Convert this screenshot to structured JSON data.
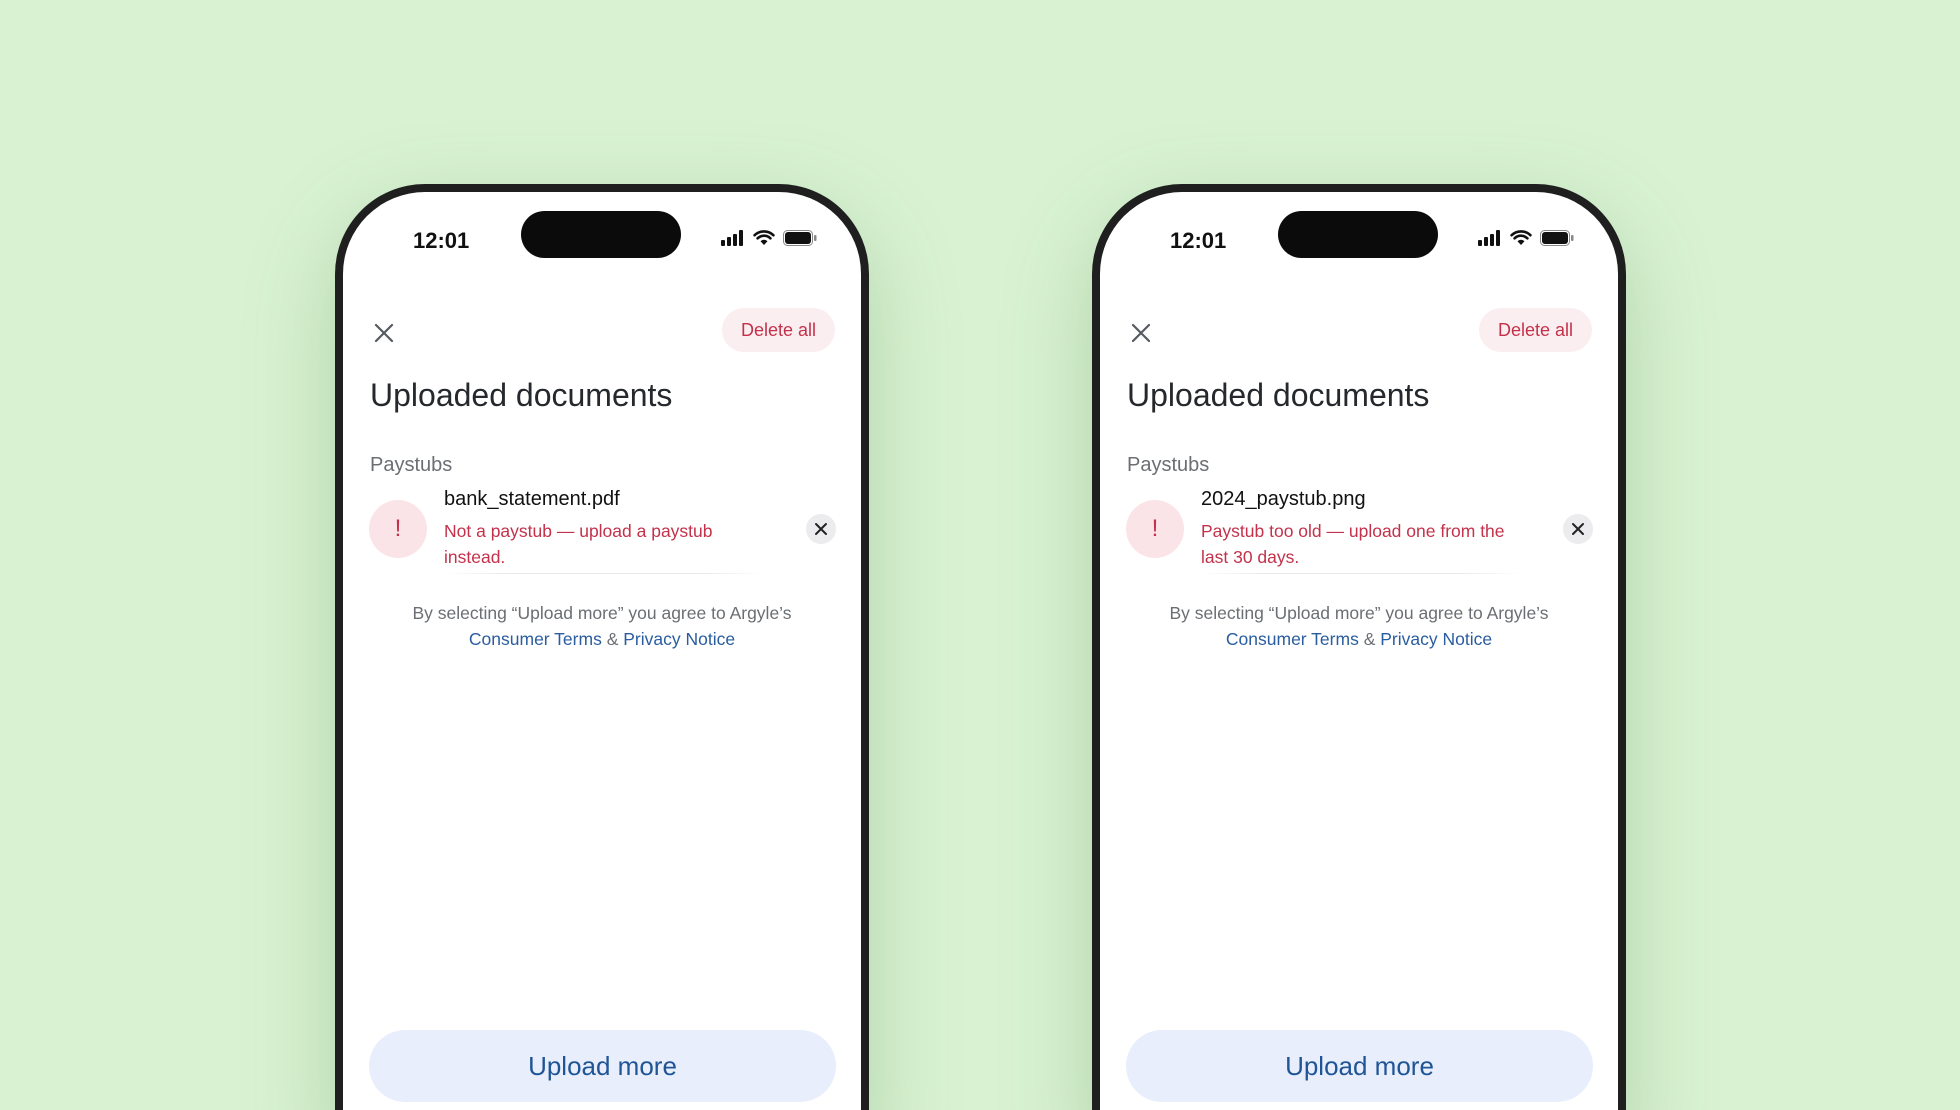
{
  "phones": [
    {
      "status_time": "12:01",
      "delete_all_label": "Delete all",
      "title": "Uploaded documents",
      "section_label": "Paystubs",
      "document": {
        "file_name": "bank_statement.pdf",
        "error": "Not a paystub — upload a paystub instead."
      },
      "consent_prefix": "By selecting “Upload more” you agree to Argyle’s",
      "consent_terms": "Consumer Terms",
      "consent_and": " & ",
      "consent_privacy": "Privacy Notice",
      "upload_label": "Upload more"
    },
    {
      "status_time": "12:01",
      "delete_all_label": "Delete all",
      "title": "Uploaded documents",
      "section_label": "Paystubs",
      "document": {
        "file_name": "2024_paystub.png",
        "error": "Paystub too old — upload one from the last 30 days."
      },
      "consent_prefix": "By selecting “Upload more” you agree to Argyle’s",
      "consent_terms": "Consumer Terms",
      "consent_and": " & ",
      "consent_privacy": "Privacy Notice",
      "upload_label": "Upload more"
    }
  ],
  "icons": {
    "alert": "!",
    "close": "close-icon",
    "remove": "x-icon"
  },
  "colors": {
    "background": "#d9f3d2",
    "error": "#c4314b",
    "link": "#2a5d9f",
    "upload_button_bg": "#e8eefb"
  }
}
